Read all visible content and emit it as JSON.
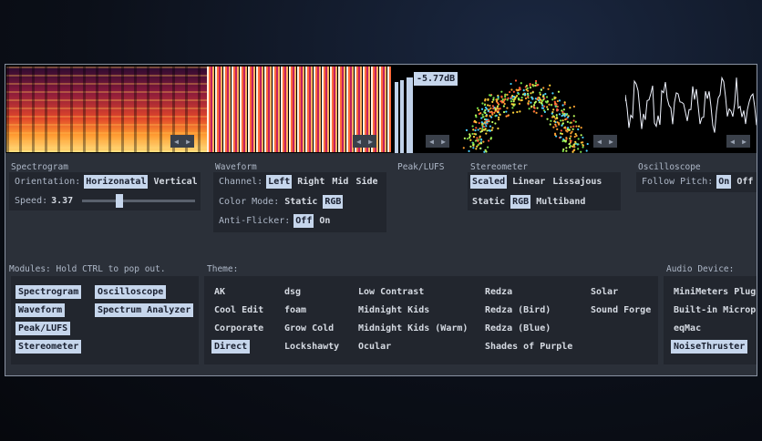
{
  "visualizers": {
    "peak_readout": "-5.77dB",
    "peak_levels": [
      0.82,
      0.84,
      0.88
    ]
  },
  "colors": {
    "selected_bg": "#c6d6ec",
    "panel": "#2b3039",
    "box": "#22262e"
  },
  "icons": {
    "nav": "left-right-arrows-icon"
  },
  "arrows": {
    "left": "◀",
    "right": "▶"
  },
  "spectrogram": {
    "title": "Spectrogram",
    "orientation_label": "Orientation:",
    "orientation_options": [
      "Horizonatal",
      "Vertical"
    ],
    "orientation_selected": "Horizonatal",
    "speed_label": "Speed:",
    "speed_value": "3.37",
    "speed_fraction": 0.33
  },
  "waveform": {
    "title": "Waveform",
    "channel_label": "Channel:",
    "channel_options": [
      "Left",
      "Right",
      "Mid",
      "Side"
    ],
    "channel_selected": "Left",
    "color_mode_label": "Color Mode:",
    "color_mode_options": [
      "Static",
      "RGB"
    ],
    "color_mode_selected": "RGB",
    "anti_flicker_label": "Anti-Flicker:",
    "anti_flicker_options": [
      "Off",
      "On"
    ],
    "anti_flicker_selected": "Off"
  },
  "peak": {
    "title": "Peak/LUFS"
  },
  "stereometer": {
    "title": "Stereometer",
    "mode_options": [
      "Scaled",
      "Linear",
      "Lissajous"
    ],
    "mode_selected": "Scaled",
    "color_options": [
      "Static",
      "RGB",
      "Multiband"
    ],
    "color_selected": "RGB"
  },
  "oscilloscope": {
    "title": "Oscilloscope",
    "follow_pitch_label": "Follow Pitch:",
    "follow_pitch_options": [
      "On",
      "Off"
    ],
    "follow_pitch_selected": "On"
  },
  "modules": {
    "title": "Modules: Hold CTRL to pop out.",
    "items": [
      "Spectrogram",
      "Waveform",
      "Peak/LUFS",
      "Stereometer",
      "Oscilloscope",
      "Spectrum Analyzer"
    ]
  },
  "theme": {
    "title": "Theme:",
    "columns": [
      [
        "AK",
        "Cool Edit",
        "Corporate",
        "Direct"
      ],
      [
        "dsg",
        "foam",
        "Grow Cold",
        "Lockshawty"
      ],
      [
        "Low Contrast",
        "Midnight Kids",
        "Midnight Kids (Warm)",
        "Ocular"
      ],
      [
        "Redza",
        "Redza (Bird)",
        "Redza (Blue)",
        "Shades of Purple"
      ],
      [
        "Solar",
        "Sound Forge"
      ]
    ],
    "selected": "Direct"
  },
  "audio_device": {
    "title": "Audio Device:",
    "items": [
      "MiniMeters Plugin",
      "Built-in Microphone",
      "eqMac",
      "NoiseThruster"
    ],
    "selected": "NoiseThruster"
  }
}
